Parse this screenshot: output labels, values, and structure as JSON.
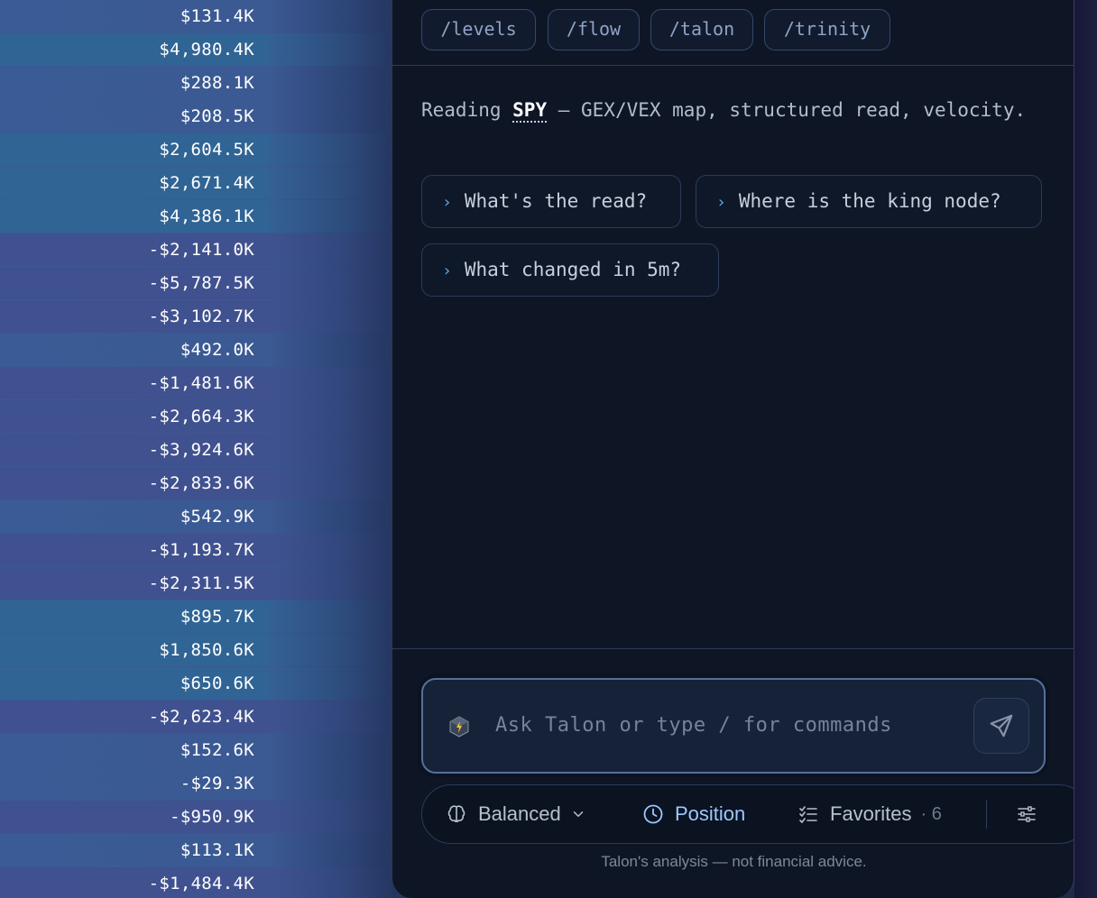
{
  "values": [
    {
      "text": "$131.4K",
      "tone": "blue"
    },
    {
      "text": "$4,980.4K",
      "tone": "teal"
    },
    {
      "text": "$288.1K",
      "tone": "blue"
    },
    {
      "text": "$208.5K",
      "tone": "blue"
    },
    {
      "text": "$2,604.5K",
      "tone": "teal"
    },
    {
      "text": "$2,671.4K",
      "tone": "teal"
    },
    {
      "text": "$4,386.1K",
      "tone": "teal"
    },
    {
      "text": "-$2,141.0K",
      "tone": "purple"
    },
    {
      "text": "-$5,787.5K",
      "tone": "purple"
    },
    {
      "text": "-$3,102.7K",
      "tone": "purple"
    },
    {
      "text": "$492.0K",
      "tone": "blue"
    },
    {
      "text": "-$1,481.6K",
      "tone": "purple"
    },
    {
      "text": "-$2,664.3K",
      "tone": "purple"
    },
    {
      "text": "-$3,924.6K",
      "tone": "purple"
    },
    {
      "text": "-$2,833.6K",
      "tone": "purple"
    },
    {
      "text": "$542.9K",
      "tone": "blue"
    },
    {
      "text": "-$1,193.7K",
      "tone": "purple"
    },
    {
      "text": "-$2,311.5K",
      "tone": "purple"
    },
    {
      "text": "$895.7K",
      "tone": "teal"
    },
    {
      "text": "$1,850.6K",
      "tone": "teal"
    },
    {
      "text": "$650.6K",
      "tone": "teal"
    },
    {
      "text": "-$2,623.4K",
      "tone": "purple"
    },
    {
      "text": "$152.6K",
      "tone": "blue"
    },
    {
      "text": "-$29.3K",
      "tone": "blue"
    },
    {
      "text": "-$950.9K",
      "tone": "purple"
    },
    {
      "text": "$113.1K",
      "tone": "blue"
    },
    {
      "text": "-$1,484.4K",
      "tone": "purple"
    }
  ],
  "commands": [
    "/levels",
    "/flow",
    "/talon",
    "/trinity"
  ],
  "intro": {
    "prefix": "Reading ",
    "ticker": "SPY",
    "suffix": " — GEX/VEX map, structured read, velocity."
  },
  "suggestions": [
    "What's the read?",
    "Where is the king node?",
    "What changed in 5m?"
  ],
  "input": {
    "placeholder": "Ask Talon or type / for commands"
  },
  "toolbar": {
    "mode_label": "Balanced",
    "position_label": "Position",
    "favorites_label": "Favorites",
    "favorites_count": "· 6"
  },
  "disclaimer": "Talon's analysis — not financial advice.",
  "colors": {
    "accent": "#9cc8ff",
    "chevron": "#5aa8e8",
    "panel_bg": "#0e1626"
  }
}
